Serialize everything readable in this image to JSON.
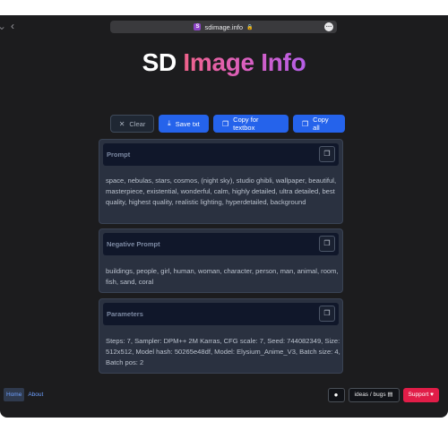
{
  "browser": {
    "url": "sdimage.info",
    "favicon_letter": "S"
  },
  "header": {
    "title_prefix": "SD",
    "title_highlight": "Image Info"
  },
  "toolbar": {
    "clear_label": "Clear",
    "save_label": "Save txt",
    "copy_textbox_label": "Copy for textbox",
    "copy_all_label": "Copy all"
  },
  "sections": {
    "prompt": {
      "title": "Prompt",
      "text": "space, nebulas, stars, cosmos, (night sky), studio ghibli, wallpaper, beautiful, masterpiece, existential, wonderful, calm, highly detailed, ultra detailed, best quality, highest quality, realistic lighting, hyperdetailed, background"
    },
    "negative_prompt": {
      "title": "Negative Prompt",
      "text": "buildings, people, girl, human, woman, character, person, man, animal, room, fish, sand, coral"
    },
    "parameters": {
      "title": "Parameters",
      "text": "Steps: 7, Sampler: DPM++ 2M Karras, CFG scale: 7, Seed: 744082349, Size: 512x512, Model hash: 50265e48df, Model: Elysium_Anime_V3, Batch size: 4, Batch pos: 2"
    }
  },
  "footer": {
    "home_label": "Home",
    "about_label": "About",
    "ideas_label": "ideas / bugs",
    "support_label": "Support"
  },
  "colors": {
    "accent": "#2563eb",
    "support": "#e11d48",
    "background": "#1c1c1e"
  },
  "icons": [
    "back-arrow-icon",
    "lock-icon",
    "more-icon",
    "close-icon",
    "download-icon",
    "copy-icon",
    "github-icon",
    "notepad-icon",
    "heart-icon"
  ]
}
